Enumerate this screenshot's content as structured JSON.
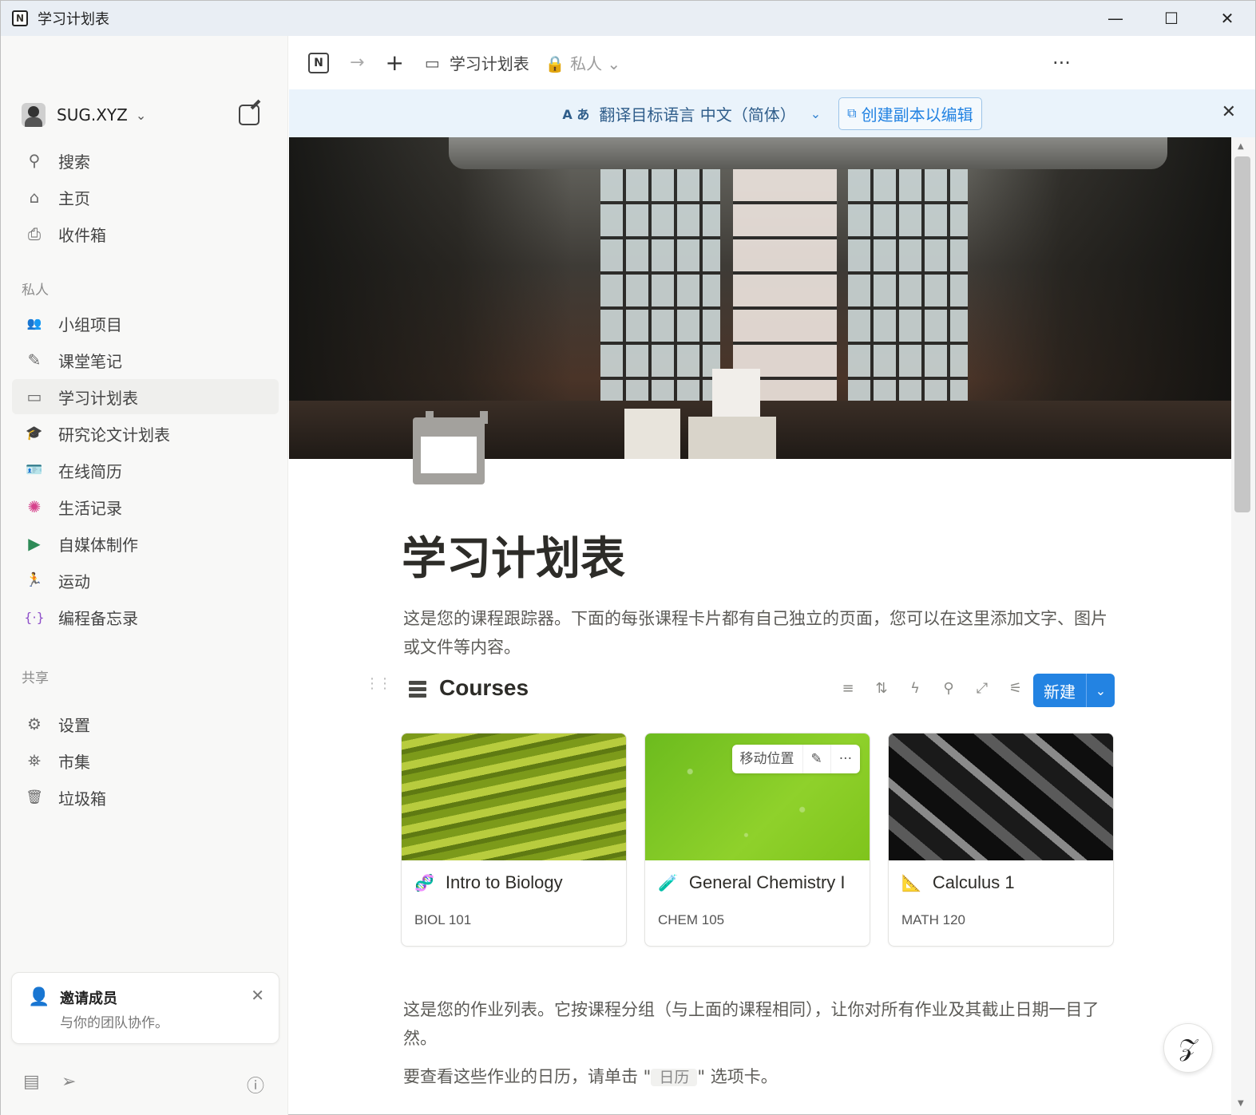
{
  "window": {
    "title": "学习计划表",
    "controls": {
      "minimize": "—",
      "maximize": "☐",
      "close": "✕"
    }
  },
  "sidebar": {
    "workspace": "SUG.XYZ",
    "top_items": [
      {
        "icon": "search-icon",
        "glyph": "⚲",
        "label": "搜索"
      },
      {
        "icon": "home-icon",
        "glyph": "⌂",
        "label": "主页"
      },
      {
        "icon": "inbox-icon",
        "glyph": "⎙",
        "label": "收件箱"
      }
    ],
    "private_label": "私人",
    "private_items": [
      {
        "icon": "group-icon",
        "glyph": "👥",
        "label": "小组项目"
      },
      {
        "icon": "pencil-icon",
        "glyph": "✎",
        "label": "课堂笔记"
      },
      {
        "icon": "calendar-icon",
        "glyph": "▭",
        "label": "学习计划表"
      },
      {
        "icon": "graduation-cap-icon",
        "glyph": "🎓",
        "label": "研究论文计划表"
      },
      {
        "icon": "badge-icon",
        "glyph": "🪪",
        "label": "在线简历"
      },
      {
        "icon": "sun-icon",
        "glyph": "✺",
        "label": "生活记录"
      },
      {
        "icon": "video-icon",
        "glyph": "▶",
        "label": "自媒体制作"
      },
      {
        "icon": "runner-icon",
        "glyph": "🏃",
        "label": "运动"
      },
      {
        "icon": "code-braces-icon",
        "glyph": "{·}",
        "label": "编程备忘录"
      }
    ],
    "shared_label": "共享",
    "bottom_items": [
      {
        "icon": "gear-icon",
        "glyph": "⚙",
        "label": "设置"
      },
      {
        "icon": "marketplace-icon",
        "glyph": "⛯",
        "label": "市集"
      },
      {
        "icon": "trash-icon",
        "glyph": "🗑",
        "label": "垃圾箱"
      }
    ],
    "invite": {
      "title": "邀请成员",
      "subtitle": "与你的团队协作。"
    }
  },
  "topbar": {
    "crumb_title": "学习计划表",
    "privacy": "私人",
    "more": "···"
  },
  "translate_bar": {
    "icon_text": "A あ",
    "text": "翻译目标语言 中文（简体）",
    "copy_button": "创建副本以编辑"
  },
  "page": {
    "title": "学习计划表",
    "description": "这是您的课程跟踪器。下面的每张课程卡片都有自己独立的页面，您可以在这里添加文字、图片或文件等内容。",
    "database_title": "Courses",
    "new_button": "新建",
    "cards": [
      {
        "title": "Intro to Biology",
        "code": "BIOL 101",
        "icon": "dna-icon",
        "glyph": "🧬",
        "image": "img-bio"
      },
      {
        "title": "General Chemistry I",
        "code": "CHEM 105",
        "icon": "test-tube-icon",
        "glyph": "🧪",
        "image": "img-chem"
      },
      {
        "title": "Calculus 1",
        "code": "MATH 120",
        "icon": "triangle-ruler-icon",
        "glyph": "📐",
        "image": "img-calc"
      }
    ],
    "card_hover": {
      "move": "移动位置",
      "edit": "✎",
      "more": "···"
    },
    "assignments_text": "这是您的作业列表。它按课程分组（与上面的课程相同），让你对所有作业及其截止日期一目了然。",
    "calendar_prefix": "要查看这些作业的日历，请单击 \"",
    "calendar_tab": "日历",
    "calendar_suffix": "\" 选项卡。"
  }
}
